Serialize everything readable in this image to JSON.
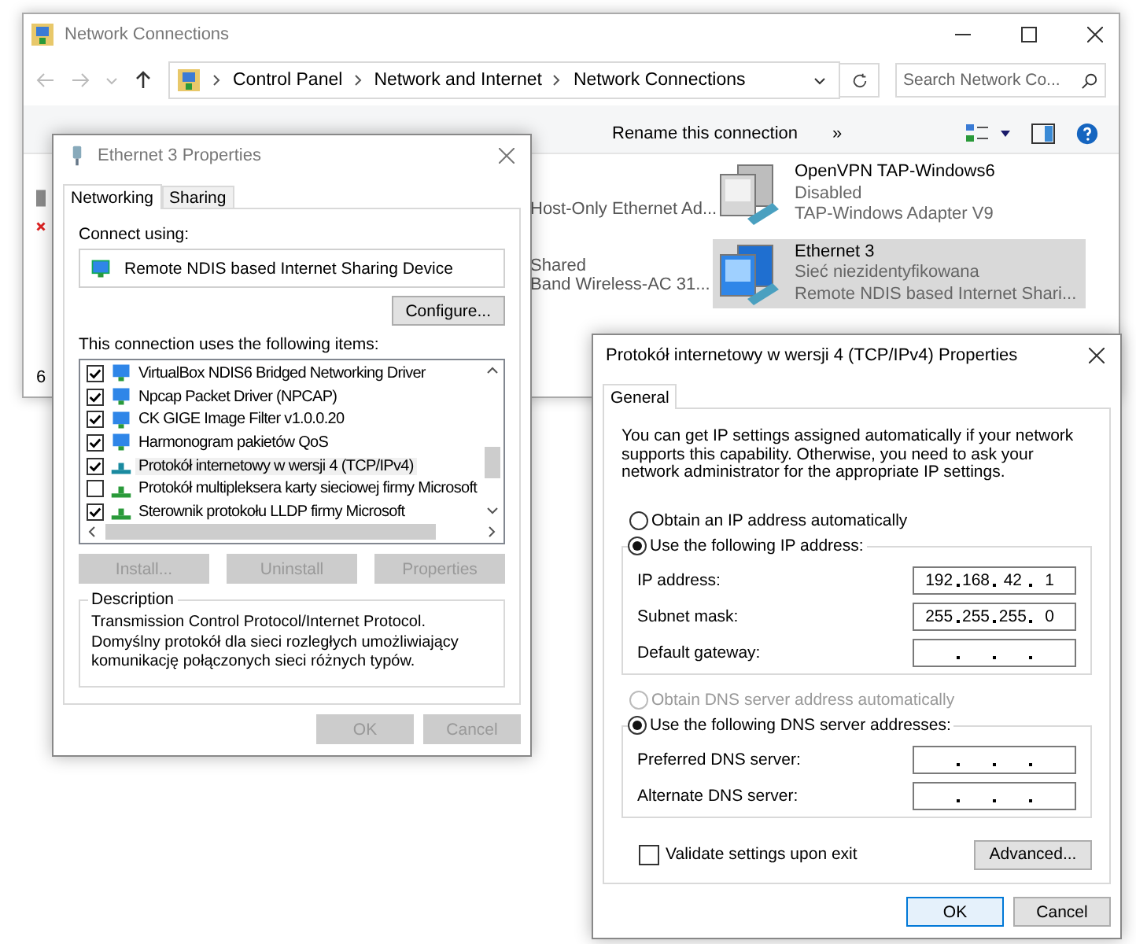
{
  "explorer": {
    "title": "Network Connections",
    "breadcrumb": [
      "Control Panel",
      "Network and Internet",
      "Network Connections"
    ],
    "search": {
      "placeholder": "Search Network Co..."
    },
    "toolbar": [
      "Rename this connection",
      "»"
    ],
    "cut_texts": [
      {
        "text": "Host-Only Ethernet Ad...",
        "kind": "device"
      },
      {
        "text": "Shared",
        "kind": "status"
      },
      {
        "text": "Band Wireless-AC 31...",
        "kind": "device"
      }
    ],
    "connections": [
      {
        "name": "OpenVPN TAP-Windows6",
        "status": "Disabled",
        "device": "TAP-Windows Adapter V9",
        "selected": false
      },
      {
        "name": "Ethernet 3",
        "status": "Sieć niezidentyfikowana",
        "device": "Remote NDIS based Internet Shari...",
        "selected": true
      }
    ],
    "status_bar": "6"
  },
  "ethernet_dialog": {
    "title": "Ethernet 3 Properties",
    "tabs": [
      {
        "label": "Networking",
        "selected": true
      },
      {
        "label": "Sharing",
        "selected": false
      }
    ],
    "connect_using": "Connect using:",
    "device": "Remote NDIS based Internet Sharing Device",
    "configure": "Configure...",
    "items_label": "This connection uses the following items:",
    "items": [
      {
        "kind": "adapter",
        "label": "VirtualBox NDIS6 Bridged Networking Driver",
        "checked": true,
        "selected": false
      },
      {
        "kind": "adapter",
        "label": "Npcap Packet Driver (NPCAP)",
        "checked": true,
        "selected": false
      },
      {
        "kind": "adapter",
        "label": "CK GIGE Image Filter v1.0.0.20",
        "checked": true,
        "selected": false
      },
      {
        "kind": "adapter",
        "label": "Harmonogram pakietów QoS",
        "checked": true,
        "selected": false
      },
      {
        "kind": "protocol",
        "label": "Protokół internetowy w wersji 4 (TCP/IPv4)",
        "checked": true,
        "selected": true
      },
      {
        "kind": "protocol",
        "label": "Protokół multipleksera karty sieciowej firmy Microsoft",
        "checked": false,
        "selected": false
      },
      {
        "kind": "protocol",
        "label": "Sterownik protokołu LLDP firmy Microsoft",
        "checked": true,
        "selected": false
      }
    ],
    "item_buttons": [
      {
        "label": "Install...",
        "disabled": true
      },
      {
        "label": "Uninstall",
        "disabled": true
      },
      {
        "label": "Properties",
        "disabled": true
      }
    ],
    "description_legend": "Description",
    "description": "Transmission Control Protocol/Internet Protocol. Domyślny protokół dla sieci rozległych umożliwiający komunikację połączonych sieci różnych typów.",
    "buttons": [
      {
        "label": "OK",
        "disabled": true
      },
      {
        "label": "Cancel",
        "disabled": true
      }
    ]
  },
  "ipv4_dialog": {
    "title": "Protokół internetowy w wersji 4 (TCP/IPv4) Properties",
    "tabs": [
      {
        "label": "General",
        "selected": true
      }
    ],
    "intro": "You can get IP settings assigned automatically if your network supports this capability. Otherwise, you need to ask your network administrator for the appropriate IP settings.",
    "ip_auto": {
      "label": "Obtain an IP address automatically",
      "selected": false,
      "disabled": false
    },
    "ip_manual": {
      "label": "Use the following IP address:",
      "selected": true,
      "disabled": false
    },
    "ip_fields": [
      {
        "label": "IP address:",
        "octets": [
          "192",
          "168",
          "42",
          "1"
        ]
      },
      {
        "label": "Subnet mask:",
        "octets": [
          "255",
          "255",
          "255",
          "0"
        ]
      },
      {
        "label": "Default gateway:"
      }
    ],
    "dns_auto": {
      "label": "Obtain DNS server address automatically",
      "selected": false,
      "disabled": true
    },
    "dns_manual": {
      "label": "Use the following DNS server addresses:",
      "selected": true,
      "disabled": false
    },
    "dns_fields": [
      {
        "label": "Preferred DNS server:"
      },
      {
        "label": "Alternate DNS server:"
      }
    ],
    "validate": {
      "label": "Validate settings upon exit",
      "checked": false
    },
    "advanced": "Advanced...",
    "buttons": [
      {
        "label": "OK",
        "default": true
      },
      {
        "label": "Cancel",
        "default": false
      }
    ]
  }
}
